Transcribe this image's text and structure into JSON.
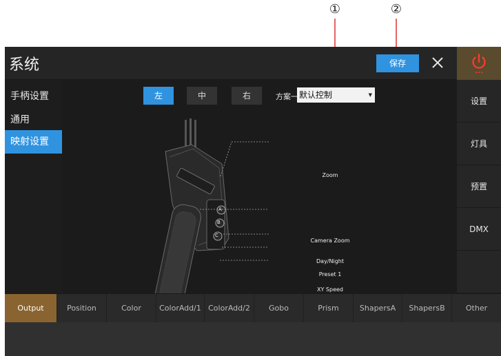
{
  "callouts": [
    "①",
    "②"
  ],
  "header": {
    "title": "系统",
    "save_label": "保存"
  },
  "icons": {
    "close": "close-icon",
    "power": "power-icon"
  },
  "left_nav": {
    "items": [
      {
        "label": "手柄设置",
        "active": false
      },
      {
        "label": "通用",
        "active": false
      },
      {
        "label": "映射设置",
        "active": true
      }
    ]
  },
  "segments": [
    {
      "label": "左",
      "active": true
    },
    {
      "label": "中",
      "active": false
    },
    {
      "label": "右",
      "active": false
    }
  ],
  "scheme": {
    "label": "方案一",
    "value": "默认控制"
  },
  "illustration_labels": {
    "zoom": "Zoom",
    "camera_zoom": "Camera Zoom",
    "day_night": "Day/Night",
    "preset": "Preset 1",
    "xy_speed": "XY Speed"
  },
  "handle_buttons": [
    "A",
    "B",
    "C"
  ],
  "right_nav": {
    "items": [
      "设置",
      "灯具",
      "预置",
      "DMX",
      ""
    ]
  },
  "tabs": [
    {
      "label": "Output",
      "active": true
    },
    {
      "label": "Position",
      "active": false
    },
    {
      "label": "Color",
      "active": false
    },
    {
      "label": "ColorAdd/1",
      "active": false
    },
    {
      "label": "ColorAdd/2",
      "active": false
    },
    {
      "label": "Gobo",
      "active": false
    },
    {
      "label": "Prism",
      "active": false
    },
    {
      "label": "ShapersA",
      "active": false
    },
    {
      "label": "ShapersB",
      "active": false
    },
    {
      "label": "Other",
      "active": false
    }
  ],
  "colors": {
    "accent": "#2f93e0",
    "active_tab": "#8a6430",
    "power_bg": "#5a4a2e",
    "power_icon": "#ff3b2f"
  }
}
